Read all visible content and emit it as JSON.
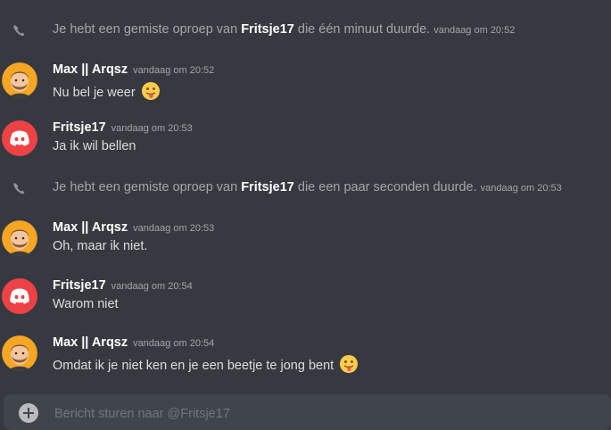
{
  "colors": {
    "background": "#36393f",
    "text": "#dcddde",
    "muted": "#a3a6aa",
    "username": "#ffffff",
    "discord_avatar": "#ed4245",
    "composer": "#40444b"
  },
  "messages": [
    {
      "type": "system",
      "icon": "phone-missed-icon",
      "text_before": "Je hebt een gemiste oproep van ",
      "user": "Fritsje17",
      "text_after": " die één minuut duurde.",
      "timestamp": "vandaag om 20:52"
    },
    {
      "type": "user",
      "author": "Max || Arqsz",
      "avatar": "bearded-man-avatar",
      "timestamp": "vandaag om 20:52",
      "text": "Nu bel je weer",
      "emoji": "tongue-out-emoji"
    },
    {
      "type": "user",
      "author": "Fritsje17",
      "avatar": "discord-logo-avatar",
      "timestamp": "vandaag om 20:53",
      "text": "Ja ik wil bellen"
    },
    {
      "type": "system",
      "icon": "phone-missed-icon",
      "text_before": "Je hebt een gemiste oproep van ",
      "user": "Fritsje17",
      "text_after": " die een paar seconden duurde.",
      "timestamp": "vandaag om 20:53"
    },
    {
      "type": "user",
      "author": "Max || Arqsz",
      "avatar": "bearded-man-avatar",
      "timestamp": "vandaag om 20:53",
      "text": "Oh, maar ik niet."
    },
    {
      "type": "user",
      "author": "Fritsje17",
      "avatar": "discord-logo-avatar",
      "timestamp": "vandaag om 20:54",
      "text": "Warom niet"
    },
    {
      "type": "user",
      "author": "Max || Arqsz",
      "avatar": "bearded-man-avatar",
      "timestamp": "vandaag om 20:54",
      "text": "Omdat ik je niet ken en je een beetje te jong bent",
      "emoji": "tongue-out-emoji"
    }
  ],
  "composer": {
    "placeholder": "Bericht sturen naar @Fritsje17",
    "value": "",
    "attach_icon": "plus-circle-icon"
  }
}
